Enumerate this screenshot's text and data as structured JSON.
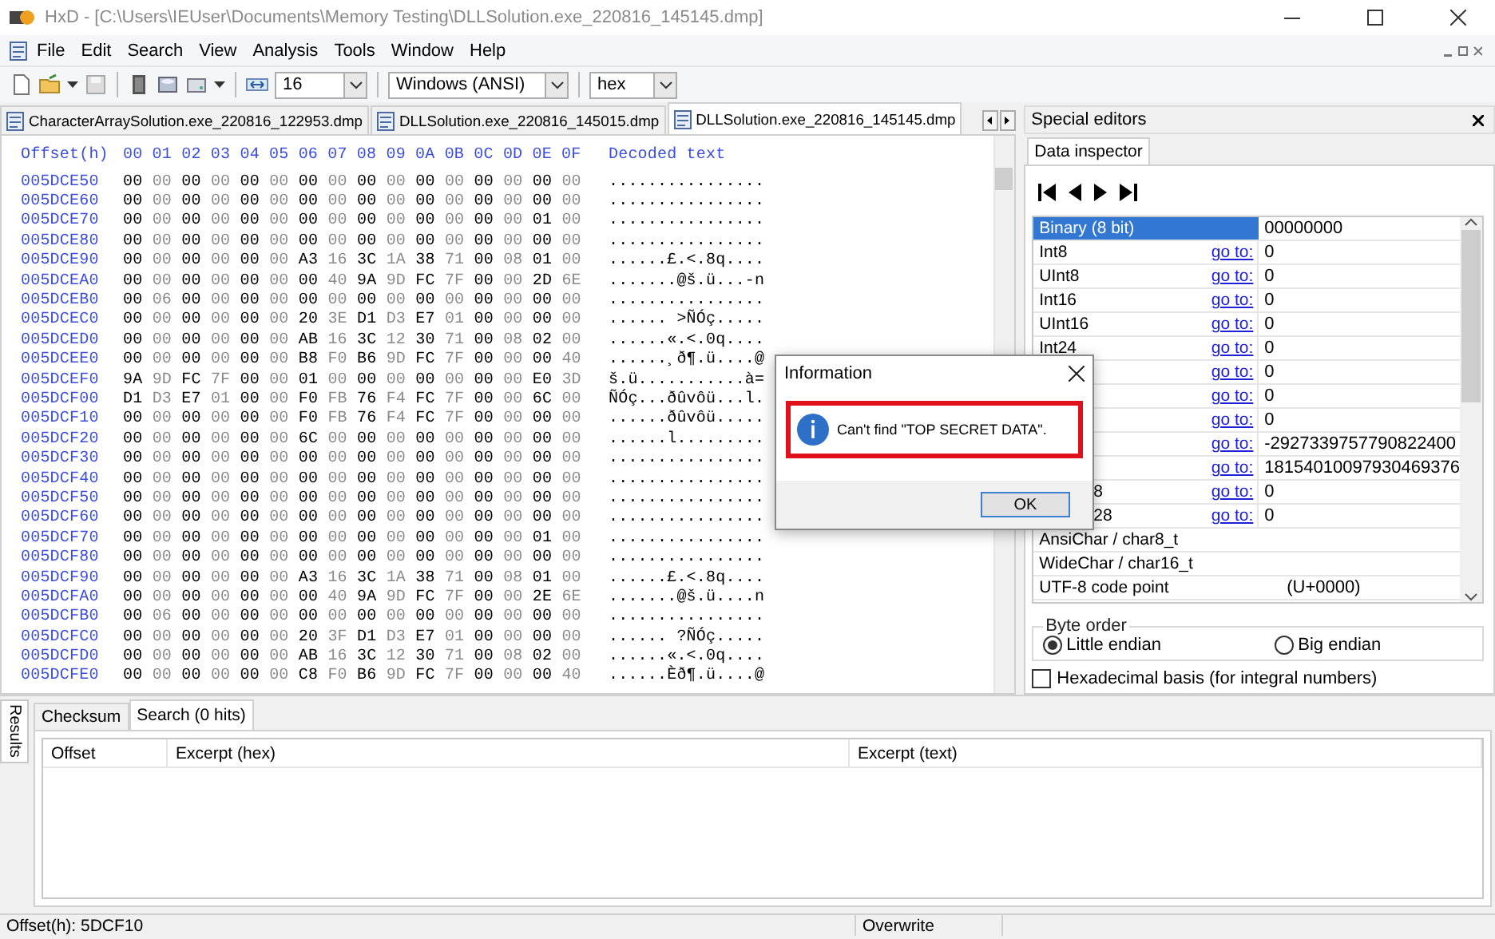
{
  "window": {
    "title": "HxD - [C:\\Users\\IEUser\\Documents\\Memory Testing\\DLLSolution.exe_220816_145145.dmp]"
  },
  "menu": [
    "File",
    "Edit",
    "Search",
    "View",
    "Analysis",
    "Tools",
    "Window",
    "Help"
  ],
  "toolbar": {
    "bytes_per_row": "16",
    "charset": "Windows (ANSI)",
    "display": "hex"
  },
  "file_tabs": [
    {
      "label": "CharacterArraySolution.exe_220816_122953.dmp",
      "selected": false
    },
    {
      "label": "DLLSolution.exe_220816_145015.dmp",
      "selected": false
    },
    {
      "label": "DLLSolution.exe_220816_145145.dmp",
      "selected": true
    }
  ],
  "hex_view": {
    "offset_header": "Offset(h)",
    "column_headers": "00 01 02 03 04 05 06 07 08 09 0A 0B 0C 0D 0E 0F",
    "decoded_header": "Decoded text",
    "rows": [
      {
        "offset": "005DCE50",
        "bytes": "00 00 00 00 00 00 00 00 00 00 00 00 00 00 00 00",
        "text": "................"
      },
      {
        "offset": "005DCE60",
        "bytes": "00 00 00 00 00 00 00 00 00 00 00 00 00 00 00 00",
        "text": "................"
      },
      {
        "offset": "005DCE70",
        "bytes": "00 00 00 00 00 00 00 00 00 00 00 00 00 00 01 00",
        "text": "................"
      },
      {
        "offset": "005DCE80",
        "bytes": "00 00 00 00 00 00 00 00 00 00 00 00 00 00 00 00",
        "text": "................"
      },
      {
        "offset": "005DCE90",
        "bytes": "00 00 00 00 00 00 A3 16 3C 1A 38 71 00 08 01 00",
        "text": "......£.<.8q...."
      },
      {
        "offset": "005DCEA0",
        "bytes": "00 00 00 00 00 00 00 40 9A 9D FC 7F 00 00 2D 6E",
        "text": ".......@š.ü...-n"
      },
      {
        "offset": "005DCEB0",
        "bytes": "00 06 00 00 00 00 00 00 00 00 00 00 00 00 00 00",
        "text": "................"
      },
      {
        "offset": "005DCEC0",
        "bytes": "00 00 00 00 00 00 20 3E D1 D3 E7 01 00 00 00 00",
        "text": "...... >ÑÓç....."
      },
      {
        "offset": "005DCED0",
        "bytes": "00 00 00 00 00 00 AB 16 3C 12 30 71 00 08 02 00",
        "text": "......«.<.0q...."
      },
      {
        "offset": "005DCEE0",
        "bytes": "00 00 00 00 00 00 B8 F0 B6 9D FC 7F 00 00 00 40",
        "text": "......¸ð¶.ü....@"
      },
      {
        "offset": "005DCEF0",
        "bytes": "9A 9D FC 7F 00 00 01 00 00 00 00 00 00 00 E0 3D",
        "text": "š.ü...........à="
      },
      {
        "offset": "005DCF00",
        "bytes": "D1 D3 E7 01 00 00 F0 FB 76 F4 FC 7F 00 00 6C 00",
        "text": "ÑÓç...ðûvôü...l."
      },
      {
        "offset": "005DCF10",
        "bytes": "00 00 00 00 00 00 F0 FB 76 F4 FC 7F 00 00 00 00",
        "text": "......ðûvôü....."
      },
      {
        "offset": "005DCF20",
        "bytes": "00 00 00 00 00 00 6C 00 00 00 00 00 00 00 00 00",
        "text": "......l........."
      },
      {
        "offset": "005DCF30",
        "bytes": "00 00 00 00 00 00 00 00 00 00 00 00 00 00 00 00",
        "text": "................"
      },
      {
        "offset": "005DCF40",
        "bytes": "00 00 00 00 00 00 00 00 00 00 00 00 00 00 00 00",
        "text": "................"
      },
      {
        "offset": "005DCF50",
        "bytes": "00 00 00 00 00 00 00 00 00 00 00 00 00 00 00 00",
        "text": "................"
      },
      {
        "offset": "005DCF60",
        "bytes": "00 00 00 00 00 00 00 00 00 00 00 00 00 00 00 00",
        "text": "................"
      },
      {
        "offset": "005DCF70",
        "bytes": "00 00 00 00 00 00 00 00 00 00 00 00 00 00 01 00",
        "text": "................"
      },
      {
        "offset": "005DCF80",
        "bytes": "00 00 00 00 00 00 00 00 00 00 00 00 00 00 00 00",
        "text": "................"
      },
      {
        "offset": "005DCF90",
        "bytes": "00 00 00 00 00 00 A3 16 3C 1A 38 71 00 08 01 00",
        "text": "......£.<.8q...."
      },
      {
        "offset": "005DCFA0",
        "bytes": "00 00 00 00 00 00 00 40 9A 9D FC 7F 00 00 2E 6E",
        "text": ".......@š.ü....n"
      },
      {
        "offset": "005DCFB0",
        "bytes": "00 06 00 00 00 00 00 00 00 00 00 00 00 00 00 00",
        "text": "................"
      },
      {
        "offset": "005DCFC0",
        "bytes": "00 00 00 00 00 00 20 3F D1 D3 E7 01 00 00 00 00",
        "text": "...... ?ÑÓç....."
      },
      {
        "offset": "005DCFD0",
        "bytes": "00 00 00 00 00 00 AB 16 3C 12 30 71 00 08 02 00",
        "text": "......«.<.0q...."
      },
      {
        "offset": "005DCFE0",
        "bytes": "00 00 00 00 00 00 C8 F0 B6 9D FC 7F 00 00 00 40",
        "text": "......Èð¶.ü....@"
      }
    ]
  },
  "special_editors": {
    "title": "Special editors",
    "tab": "Data inspector",
    "rows": [
      {
        "label": "Binary (8 bit)",
        "value": "00000000",
        "selected": true
      },
      {
        "label": "Int8",
        "link": "go to:",
        "value": "0",
        "selected": false
      },
      {
        "label": "UInt8",
        "link": "go to:",
        "value": "0",
        "selected": false
      },
      {
        "label": "Int16",
        "link": "go to:",
        "value": "0",
        "selected": false
      },
      {
        "label": "UInt16",
        "link": "go to:",
        "value": "0",
        "selected": false
      },
      {
        "label": "Int24",
        "link": "go to:",
        "value": "0",
        "selected": false
      },
      {
        "link": "go to:",
        "value": "0",
        "selected": false
      },
      {
        "link": "go to:",
        "value": "0",
        "selected": false
      },
      {
        "link": "go to:",
        "value": "0",
        "selected": false
      },
      {
        "link": "go to:",
        "value": "-2927339757790822400",
        "selected": false
      },
      {
        "link": "go to:",
        "value": "18154010097930469376",
        "selected": false
      },
      {
        "label": "8",
        "link": "go to:",
        "value": "0",
        "selected": false
      },
      {
        "label": "28",
        "link": "go to:",
        "value": "0",
        "selected": false
      },
      {
        "label": "AnsiChar / char8_t",
        "selected": false
      },
      {
        "label": "WideChar / char16_t",
        "selected": false
      },
      {
        "label": "UTF-8 code point",
        "value": "(U+0000)",
        "selected": false
      }
    ],
    "byte_order": {
      "title": "Byte order",
      "options": [
        {
          "label": "Little endian",
          "selected": true
        },
        {
          "label": "Big endian",
          "selected": false
        }
      ]
    },
    "hex_basis": {
      "label": "Hexadecimal basis (for integral numbers)",
      "checked": false
    }
  },
  "results": {
    "side_tab": "Results",
    "tabs": [
      {
        "label": "Checksum",
        "selected": false
      },
      {
        "label": "Search (0 hits)",
        "selected": true
      }
    ],
    "columns": [
      "Offset",
      "Excerpt (hex)",
      "Excerpt (text)"
    ]
  },
  "status_bar": [
    "Offset(h): 5DCF10",
    "Overwrite"
  ],
  "dialog": {
    "title": "Information",
    "message": "Can't find \"TOP SECRET DATA\".",
    "highlighted": true,
    "button": "OK"
  }
}
